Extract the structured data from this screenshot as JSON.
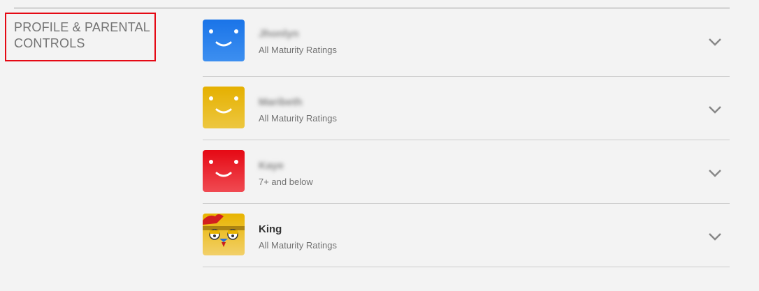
{
  "section": {
    "title": "PROFILE & PARENTAL CONTROLS"
  },
  "profiles": [
    {
      "name": "Jhonlyn",
      "rating": "All Maturity Ratings",
      "avatar": "blue-smiley-avatar",
      "color_top": "#1a74e8",
      "color_bottom": "#3d8ff0"
    },
    {
      "name": "Maribeth",
      "rating": "All Maturity Ratings",
      "avatar": "yellow-smiley-avatar",
      "color_top": "#e5b000",
      "color_bottom": "#edc740"
    },
    {
      "name": "Kaye",
      "rating": "7+ and below",
      "avatar": "red-smiley-avatar",
      "color_top": "#e50914",
      "color_bottom": "#f04a52"
    },
    {
      "name": "King",
      "rating": "All Maturity Ratings",
      "avatar": "chicken-avatar",
      "color_top": "#e8b400",
      "color_bottom": "#f2d06a"
    }
  ],
  "icons": {
    "expand": "chevron-down-icon"
  }
}
